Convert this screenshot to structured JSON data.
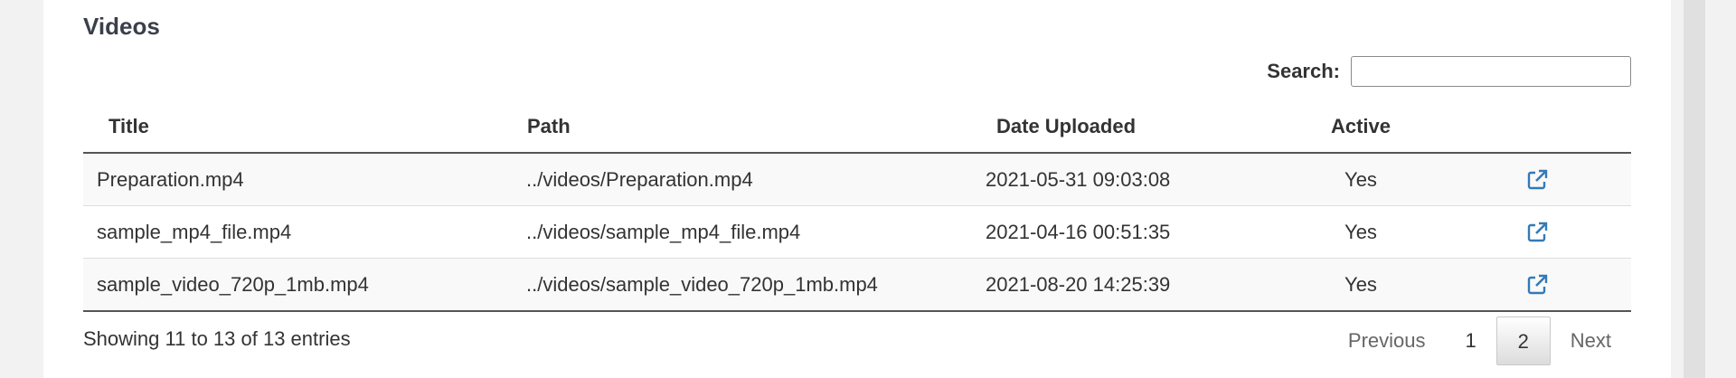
{
  "section": {
    "title": "Videos"
  },
  "search": {
    "label": "Search:",
    "value": ""
  },
  "table": {
    "headers": {
      "title": "Title",
      "path": "Path",
      "date": "Date Uploaded",
      "active": "Active"
    },
    "rows": [
      {
        "title": "Preparation.mp4",
        "path": "../videos/Preparation.mp4",
        "date": "2021-05-31 09:03:08",
        "active": "Yes",
        "icon": "external-link-icon"
      },
      {
        "title": "sample_mp4_file.mp4",
        "path": "../videos/sample_mp4_file.mp4",
        "date": "2021-04-16 00:51:35",
        "active": "Yes",
        "icon": "external-link-icon"
      },
      {
        "title": "sample_video_720p_1mb.mp4",
        "path": "../videos/sample_video_720p_1mb.mp4",
        "date": "2021-08-20 14:25:39",
        "active": "Yes",
        "icon": "external-link-icon"
      }
    ]
  },
  "footer": {
    "info": "Showing 11 to 13 of 13 entries"
  },
  "pagination": {
    "previous": "Previous",
    "pages": [
      "1",
      "2"
    ],
    "current": "2",
    "next": "Next"
  },
  "colors": {
    "link_icon": "#337ab7",
    "header_border": "#555555"
  }
}
